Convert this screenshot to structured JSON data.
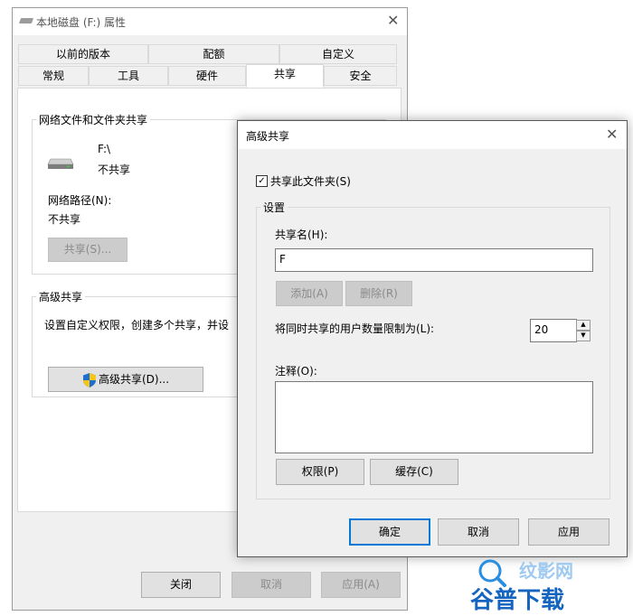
{
  "props": {
    "title": "本地磁盘 (F:) 属性",
    "tabs_row1": [
      "以前的版本",
      "配额",
      "自定义"
    ],
    "tabs_row2": [
      "常规",
      "工具",
      "硬件",
      "共享",
      "安全"
    ],
    "active_tab": "共享",
    "network_group": {
      "legend": "网络文件和文件夹共享",
      "drive_name": "F:\\",
      "share_status": "不共享",
      "network_path_label": "网络路径(N):",
      "network_path_value": "不共享",
      "share_button": "共享(S)..."
    },
    "advanced_group": {
      "legend": "高级共享",
      "description": "设置自定义权限，创建多个共享，并设",
      "button": "高级共享(D)..."
    },
    "buttons": {
      "close": "关闭",
      "cancel": "取消",
      "apply": "应用(A)"
    }
  },
  "adv": {
    "title": "高级共享",
    "share_checkbox_label": "共享此文件夹(S)",
    "share_checked": true,
    "settings_legend": "设置",
    "share_name_label": "共享名(H):",
    "share_name_value": "F",
    "add_button": "添加(A)",
    "remove_button": "删除(R)",
    "user_limit_label": "将同时共享的用户数量限制为(L):",
    "user_limit_value": "20",
    "comment_label": "注释(O):",
    "comment_value": "",
    "permissions_button": "权限(P)",
    "cache_button": "缓存(C)",
    "ok_button": "确定",
    "cancel_button": "取消",
    "apply_button": "应用"
  },
  "watermark": {
    "top": "纹影网",
    "bottom": "谷普下载"
  },
  "colors": {
    "accent": "#0078d7",
    "watermark": "#1565c0"
  }
}
